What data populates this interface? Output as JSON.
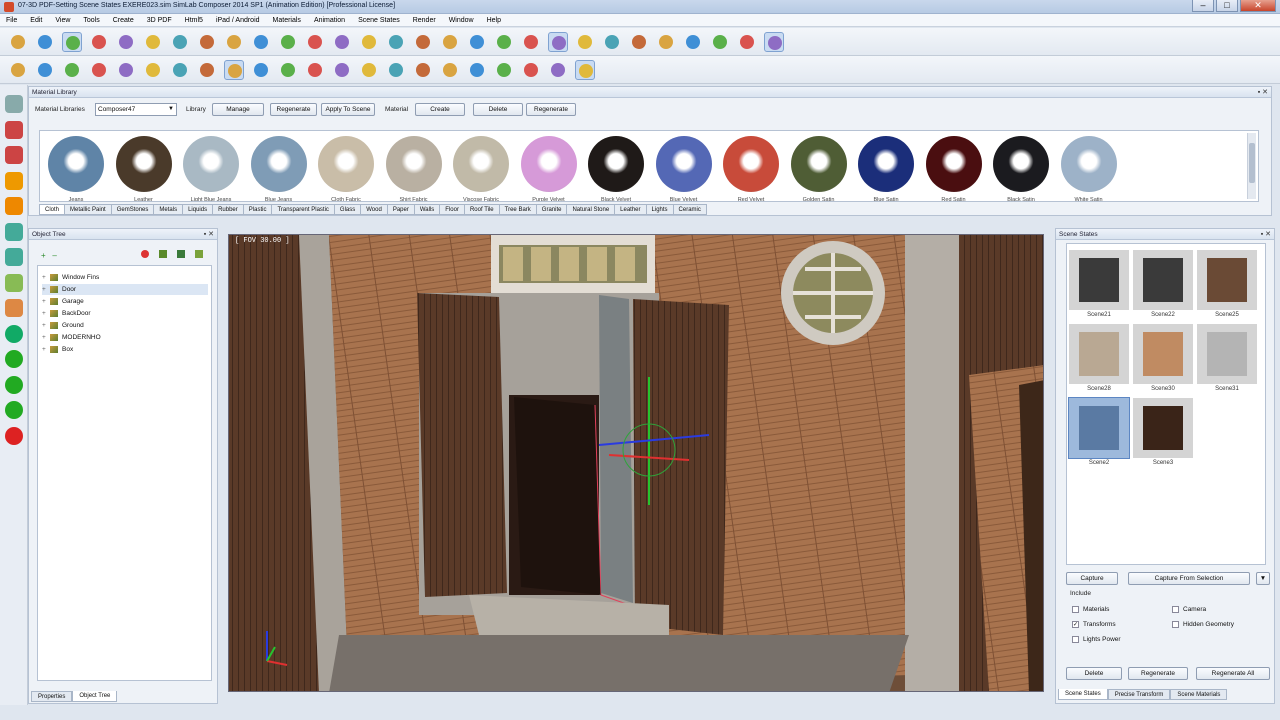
{
  "window": {
    "title": "07-3D PDF-Setting Scene States EXERE023.sim SimLab Composer 2014 SP1 (Animation Edition)  [Professional License]",
    "min": "–",
    "max": "□",
    "close": "✕"
  },
  "menu": [
    "File",
    "Edit",
    "View",
    "Tools",
    "Create",
    "3D PDF",
    "Html5",
    "iPad / Android",
    "Materials",
    "Animation",
    "Scene States",
    "Render",
    "Window",
    "Help"
  ],
  "toolbar_icons_row1": [
    "cursor",
    "lasso",
    "select-box",
    "select-face",
    "move",
    "rotate",
    "scale",
    "pivot",
    "snap",
    "paint",
    "hide",
    "show",
    "isolate",
    "explode",
    "reset",
    "delete",
    "undo",
    "redo",
    "cube",
    "zoom-extents",
    "zoom-selected",
    "zoom-window",
    "orbit",
    "light-sun",
    "light-spot",
    "light-point",
    "light-area",
    "sun",
    "render"
  ],
  "toolbar_icons_row2": [
    "globe",
    "cube-green",
    "shield",
    "camera-orbit",
    "camera-pan",
    "camera-zoom",
    "camera-walk",
    "camera-active",
    "material-pick",
    "snapshot",
    "photo",
    "capture",
    "puzzle",
    "cup",
    "bucket",
    "flower",
    "car",
    "bottle",
    "person",
    "monitor",
    "diamond",
    "gradient"
  ],
  "material_library": {
    "panel_title": "Material Library",
    "libraries_label": "Material Libraries",
    "libraries_value": "Composer47",
    "library_label": "Library",
    "manage": "Manage",
    "regenerate1": "Regenerate",
    "apply": "Apply To Scene",
    "material_label": "Material",
    "create": "Create",
    "delete": "Delete",
    "regenerate2": "Regenerate",
    "swatches": [
      {
        "name": "Jeans",
        "color": "#5f84a7"
      },
      {
        "name": "Leather",
        "color": "#4a3a2a"
      },
      {
        "name": "Light Blue Jeans",
        "color": "#a9b9c4"
      },
      {
        "name": "Blue Jeans",
        "color": "#7f9cb6"
      },
      {
        "name": "Cloth Fabric",
        "color": "#c9bda8"
      },
      {
        "name": "Shirt Fabric",
        "color": "#b9b0a2"
      },
      {
        "name": "Viscose Fabric",
        "color": "#c1baa8"
      },
      {
        "name": "Purple Velvet",
        "color": "#d69ad8"
      },
      {
        "name": "Black Velvet",
        "color": "#1f1a18"
      },
      {
        "name": "Blue Velvet",
        "color": "#5468b5"
      },
      {
        "name": "Red Velvet",
        "color": "#c84b3a"
      },
      {
        "name": "Golden Satin",
        "color": "#4f5d35"
      },
      {
        "name": "Blue Satin",
        "color": "#1b2e7a"
      },
      {
        "name": "Red Satin",
        "color": "#4a0e10"
      },
      {
        "name": "Black Satin",
        "color": "#1b1b1f"
      },
      {
        "name": "White Satin",
        "color": "#9db2c8"
      }
    ],
    "categories": [
      "Cloth",
      "Metallic Paint",
      "GemStones",
      "Metals",
      "Liquids",
      "Rubber",
      "Plastic",
      "Transparent Plastic",
      "Glass",
      "Wood",
      "Paper",
      "Walls",
      "Floor",
      "Roof Tile",
      "Tree Bark",
      "Granite",
      "Natural Stone",
      "Leather",
      "Lights",
      "Ceramic"
    ]
  },
  "object_tree": {
    "panel_title": "Object Tree",
    "items": [
      {
        "label": "Window Fins",
        "selected": false
      },
      {
        "label": "Door",
        "selected": true
      },
      {
        "label": "Garage",
        "selected": false
      },
      {
        "label": "BackDoor",
        "selected": false
      },
      {
        "label": "Ground",
        "selected": false
      },
      {
        "label": "MODERNHO",
        "selected": false
      },
      {
        "label": "Box",
        "selected": false
      }
    ],
    "tabs": [
      "Properties",
      "Object Tree"
    ],
    "active_tab": "Object Tree"
  },
  "viewport": {
    "fov_label": "[ FOV 30.00 ]"
  },
  "scene_states": {
    "panel_title": "Scene States",
    "scenes": [
      {
        "label": "Scene21",
        "color": "#3a3a3a"
      },
      {
        "label": "Scene22",
        "color": "#3a3a3a"
      },
      {
        "label": "Scene25",
        "color": "#6a4a35"
      },
      {
        "label": "Scene28",
        "color": "#b9a893"
      },
      {
        "label": "Scene30",
        "color": "#c08b62"
      },
      {
        "label": "Scene31",
        "color": "#b4b4b4"
      },
      {
        "label": "Scene2",
        "color": "#5a7aa3"
      },
      {
        "label": "Scene3",
        "color": "#3a2418"
      }
    ],
    "selected": "Scene2",
    "capture": "Capture",
    "capture_from_selection": "Capture From Selection",
    "include_label": "Include",
    "options": [
      {
        "label": "Materials",
        "checked": false
      },
      {
        "label": "Camera",
        "checked": false
      },
      {
        "label": "Transforms",
        "checked": true
      },
      {
        "label": "Hidden Geometry",
        "checked": false
      },
      {
        "label": "Lights Power",
        "checked": false
      }
    ],
    "delete": "Delete",
    "regenerate": "Regenerate",
    "regenerate_all": "Regenerate All",
    "tabs": [
      "Scene States",
      "Precise Transform",
      "Scene Materials"
    ],
    "active_tab": "Scene States"
  }
}
